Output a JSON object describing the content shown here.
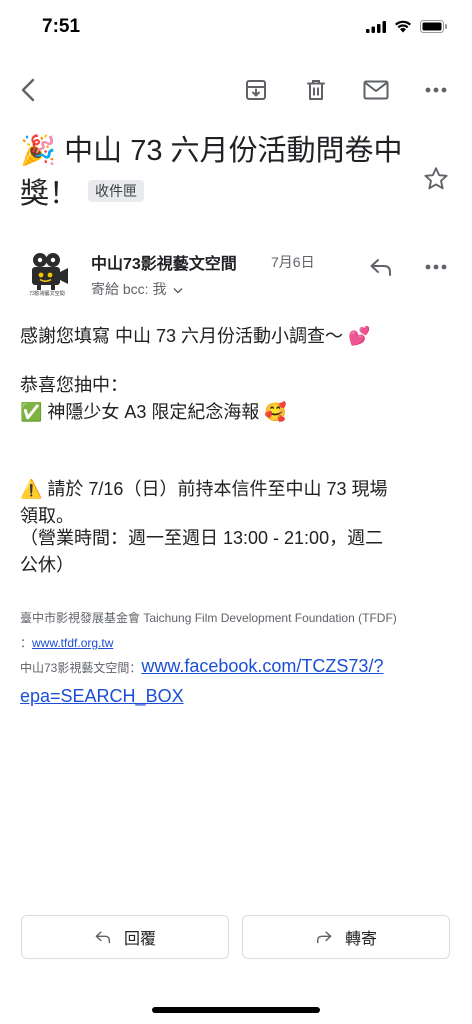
{
  "status_bar": {
    "time": "7:51"
  },
  "subject": {
    "emoji": "🎉",
    "text": "中山 73 六月份活動問卷中獎！",
    "label_chip": "收件匣"
  },
  "sender": {
    "name": "中山73影視藝文空間",
    "date": "7月6日",
    "to_line": "寄給 bcc: 我",
    "avatar_caption": "73影視藝文空間"
  },
  "body": {
    "line1": "感謝您填寫 中山 73 六月份活動小調查～ 💕",
    "congrats": "恭喜您抽中：",
    "prize": "✅ 神隱少女 A3 限定紀念海報 🥰",
    "notice_line1": "⚠️ 請於 7/16（日）前持本信件至中山 73 現場",
    "notice_line2": "領取。",
    "hours_line1": "（營業時間：週一至週日 13:00 - 21:00，週二",
    "hours_line2": "公休）"
  },
  "footer": {
    "foundation": "臺中市影視發展基金會 Taichung Film Development Foundation (TFDF)",
    "colon": "：",
    "tfdf_link": "www.tfdf.org.tw",
    "fb_label": "中山73影視藝文空間：",
    "fb_link_line1": "www.facebook.com/TCZS73/?",
    "fb_link_line2": "epa=SEARCH_BOX"
  },
  "actions": {
    "reply_label": "回覆",
    "forward_label": "轉寄"
  },
  "colors": {
    "link": "#1a4fd6",
    "icon_gray": "#5f6368",
    "chip_bg": "#e8eaed"
  }
}
